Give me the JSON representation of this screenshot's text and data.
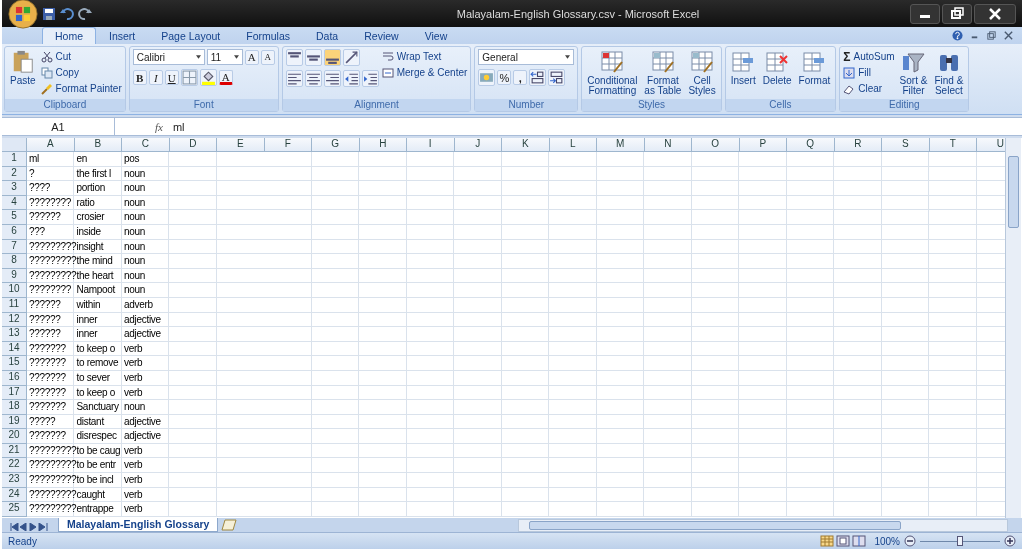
{
  "window": {
    "title": "Malayalam-English Glossary.csv - Microsoft Excel"
  },
  "tabs": [
    {
      "label": "Home",
      "selected": true
    },
    {
      "label": "Insert",
      "selected": false
    },
    {
      "label": "Page Layout",
      "selected": false
    },
    {
      "label": "Formulas",
      "selected": false
    },
    {
      "label": "Data",
      "selected": false
    },
    {
      "label": "Review",
      "selected": false
    },
    {
      "label": "View",
      "selected": false
    }
  ],
  "ribbon": {
    "clipboard": {
      "label": "Clipboard",
      "paste": "Paste",
      "items": [
        "Cut",
        "Copy",
        "Format Painter"
      ]
    },
    "font": {
      "label": "Font",
      "name": "Calibri",
      "size": "11",
      "grow": "A",
      "shrink": "A",
      "styles": [
        "B",
        "I",
        "U"
      ],
      "color_letter": "A"
    },
    "alignment": {
      "label": "Alignment",
      "wrap": "Wrap Text",
      "merge": "Merge & Center"
    },
    "number": {
      "label": "Number",
      "format": "General",
      "percent": "%",
      "comma": ","
    },
    "styles": {
      "label": "Styles",
      "buttons": [
        {
          "line1": "Conditional",
          "line2": "Formatting"
        },
        {
          "line1": "Format",
          "line2": "as Table"
        },
        {
          "line1": "Cell",
          "line2": "Styles"
        }
      ]
    },
    "cells": {
      "label": "Cells",
      "buttons": [
        "Insert",
        "Delete",
        "Format"
      ]
    },
    "editing": {
      "label": "Editing",
      "sigma": "Σ",
      "items": [
        "AutoSum",
        "Fill",
        "Clear"
      ],
      "big": [
        {
          "line1": "Sort &",
          "line2": "Filter"
        },
        {
          "line1": "Find &",
          "line2": "Select"
        }
      ]
    }
  },
  "formula_bar": {
    "name_box": "A1",
    "fx": "fx",
    "value": "ml"
  },
  "sheet": {
    "columns": [
      "A",
      "B",
      "C",
      "D",
      "E",
      "F",
      "G",
      "H",
      "I",
      "J",
      "K",
      "L",
      "M",
      "N",
      "O",
      "P",
      "Q",
      "R",
      "S",
      "T",
      "U"
    ],
    "rows": [
      {
        "n": "1",
        "cells": [
          "ml",
          "en",
          "pos"
        ]
      },
      {
        "n": "2",
        "cells": [
          "?",
          "the first l",
          "noun"
        ]
      },
      {
        "n": "3",
        "cells": [
          "????",
          "portion",
          "noun"
        ]
      },
      {
        "n": "4",
        "cells": [
          "????????",
          "ratio",
          "noun"
        ]
      },
      {
        "n": "5",
        "cells": [
          "??????",
          "crosier",
          "noun"
        ]
      },
      {
        "n": "6",
        "cells": [
          "???",
          "inside",
          "noun"
        ]
      },
      {
        "n": "7",
        "cells": [
          "?????????",
          "insight",
          "noun"
        ]
      },
      {
        "n": "8",
        "cells": [
          "?????????",
          "the mind",
          "noun"
        ]
      },
      {
        "n": "9",
        "cells": [
          "?????????",
          "the heart",
          "noun"
        ]
      },
      {
        "n": "10",
        "cells": [
          "????????",
          "Nampoot",
          "noun"
        ]
      },
      {
        "n": "11",
        "cells": [
          "??????",
          "within",
          "adverb"
        ]
      },
      {
        "n": "12",
        "cells": [
          "??????",
          "inner",
          "adjective"
        ]
      },
      {
        "n": "13",
        "cells": [
          "??????",
          "inner",
          "adjective"
        ]
      },
      {
        "n": "14",
        "cells": [
          "???????",
          "to keep o",
          "verb"
        ]
      },
      {
        "n": "15",
        "cells": [
          "???????",
          "to remove",
          "verb"
        ]
      },
      {
        "n": "16",
        "cells": [
          "???????",
          "to sever",
          "verb"
        ]
      },
      {
        "n": "17",
        "cells": [
          "???????",
          "to keep o",
          "verb"
        ]
      },
      {
        "n": "18",
        "cells": [
          "???????",
          "Sanctuary",
          "noun"
        ]
      },
      {
        "n": "19",
        "cells": [
          "?????",
          "distant",
          "adjective"
        ]
      },
      {
        "n": "20",
        "cells": [
          "???????",
          "disrespec",
          "adjective"
        ]
      },
      {
        "n": "21",
        "cells": [
          "?????????",
          "to be caug",
          "verb"
        ]
      },
      {
        "n": "22",
        "cells": [
          "?????????",
          "to be entr",
          "verb"
        ]
      },
      {
        "n": "23",
        "cells": [
          "?????????",
          "to be incl",
          "verb"
        ]
      },
      {
        "n": "24",
        "cells": [
          "?????????",
          "caught",
          "verb"
        ]
      },
      {
        "n": "25",
        "cells": [
          "?????????",
          "entrappe",
          "verb"
        ]
      }
    ]
  },
  "sheet_tabs": [
    {
      "label": "Malayalam-English Glossary",
      "selected": true
    }
  ],
  "status_bar": {
    "text": "Ready",
    "zoom": "100%",
    "level": 0.5
  }
}
